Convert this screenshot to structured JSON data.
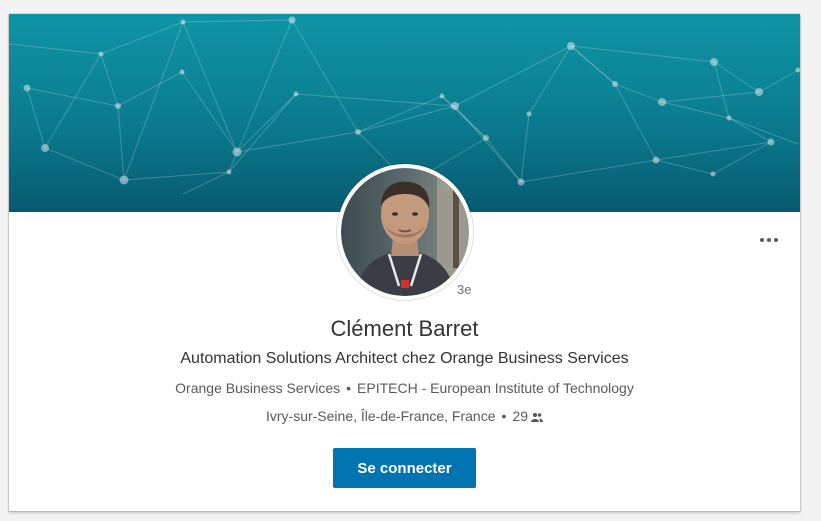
{
  "profile": {
    "name": "Clément Barret",
    "headline": "Automation Solutions Architect chez Orange Business Services",
    "company": "Orange Business Services",
    "education": "EPITECH - European Institute of Technology",
    "location": "Ivry-sur-Seine, Île-de-France, France",
    "connections": "29",
    "degree": "3e",
    "bullet": "•"
  },
  "actions": {
    "connect_label": "Se connecter"
  },
  "icons": {
    "more": "more-options-icon",
    "connections": "people-icon"
  },
  "colors": {
    "accent": "#0073b1",
    "banner_top": "#0f8fa0",
    "banner_bottom": "#085f73"
  }
}
